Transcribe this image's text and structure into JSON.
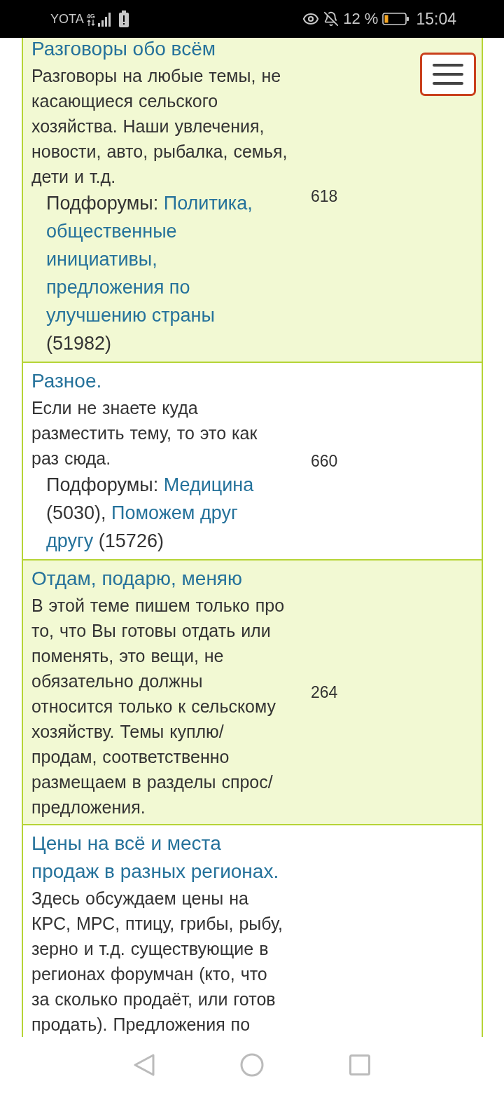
{
  "status_bar": {
    "carrier": "YOTA",
    "network": "4G",
    "battery": "12 %",
    "time": "15:04"
  },
  "forums": [
    {
      "title": "Разговоры обо всём",
      "description": "Разговоры на любые темы, не касающиеся сельского хозяйства. Наши увлечения, новости, авто, рыбалка, семья, дети и т.д.",
      "subforums_label": "Подфорумы:",
      "subforums": [
        {
          "name": "Политика, общественные инициативы, предложения по улучшению страны",
          "count": "(51982)"
        }
      ],
      "topics": "618"
    },
    {
      "title": "Разное.",
      "description": "Если не знаете куда разместить тему, то это как раз сюда.",
      "subforums_label": "Подфорумы:",
      "subforums": [
        {
          "name": "Медицина",
          "count": "(5030)",
          "separator": ","
        },
        {
          "name": "Поможем друг другу",
          "count": "(15726)"
        }
      ],
      "topics": "660"
    },
    {
      "title": "Отдам, подарю, меняю",
      "description": "В этой теме пишем только про то, что Вы готовы отдать или поменять, это вещи, не обязательно должны относится только к сельскому хозяйству. Темы куплю/продам, соответственно размещаем в разделы спрос/предложения.",
      "topics": "264"
    },
    {
      "title": "Цены на всё и места продаж в разных регионах.",
      "description": "Здесь обсуждаем цены на КРС, МРС, птицу, грибы, рыбу, зерно и т.д. существующие в регионах форумчан (кто, что за сколько продаёт, или готов продать). Предложения по"
    }
  ]
}
